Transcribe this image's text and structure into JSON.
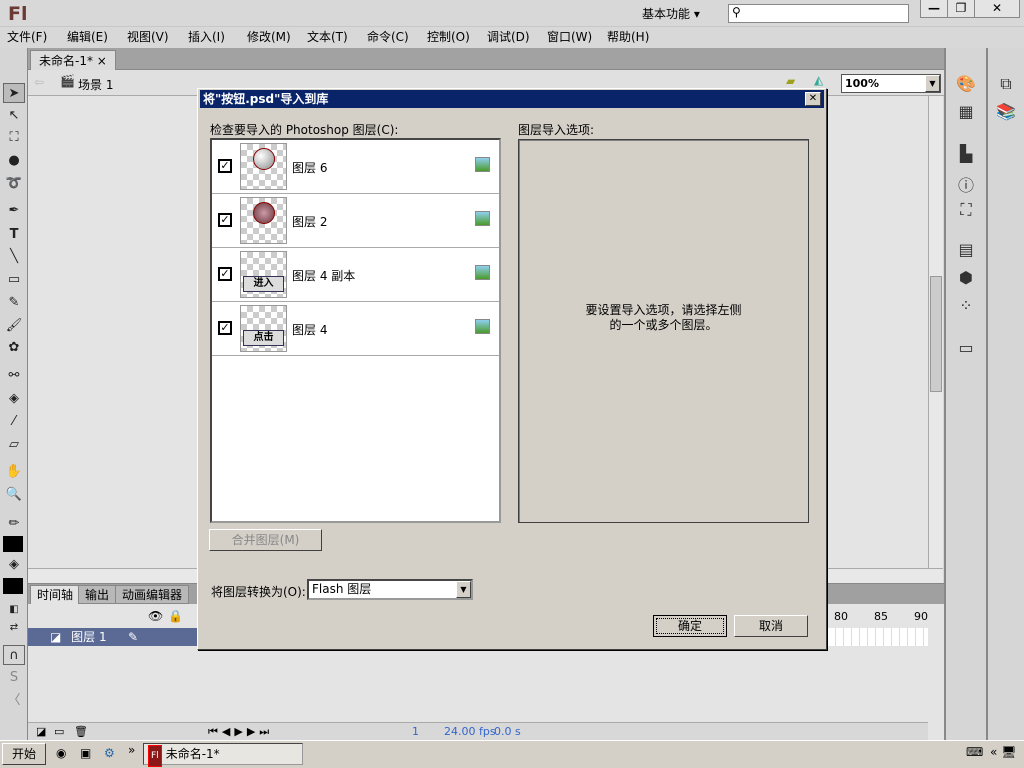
{
  "app": {
    "logo": "Fl",
    "workspace": "基本功能 ▾",
    "search_placeholder": "",
    "win_min": "—",
    "win_restore": "❐",
    "win_close": "✕"
  },
  "menu": [
    "文件(F)",
    "编辑(E)",
    "视图(V)",
    "插入(I)",
    "修改(M)",
    "文本(T)",
    "命令(C)",
    "控制(O)",
    "调试(D)",
    "窗口(W)",
    "帮助(H)"
  ],
  "document": {
    "tab": "未命名-1*",
    "tab_close": "×",
    "scene": "场景 1",
    "zoom": "100%"
  },
  "timeline": {
    "tabs": [
      "时间轴",
      "输出",
      "动画编辑器"
    ],
    "layer": "图层 1",
    "ruler": [
      "80",
      "85",
      "90"
    ],
    "frame": "1",
    "fps": "24.00 fps",
    "time": "0.0 s"
  },
  "dialog": {
    "title": "将\"按钮.psd\"导入到库",
    "close": "✕",
    "list_label": "检查要导入的 Photoshop 图层(C):",
    "options_label": "图层导入选项:",
    "layers": [
      {
        "name": "图层 6",
        "checked": true,
        "thumb": ""
      },
      {
        "name": "图层 2",
        "checked": true,
        "thumb": ""
      },
      {
        "name": "图层 4 副本",
        "checked": true,
        "thumb": "进入"
      },
      {
        "name": "图层 4",
        "checked": true,
        "thumb": "点击"
      }
    ],
    "options_hint_1": "要设置导入选项，请选择左侧",
    "options_hint_2": "的一个或多个图层。",
    "merge": "合并图层(M)",
    "convert_label": "将图层转换为(O):",
    "convert_value": "Flash 图层",
    "ok": "确定",
    "cancel": "取消"
  },
  "taskbar": {
    "start": "开始",
    "task": "未命名-1*",
    "task_icon": "Fl"
  }
}
